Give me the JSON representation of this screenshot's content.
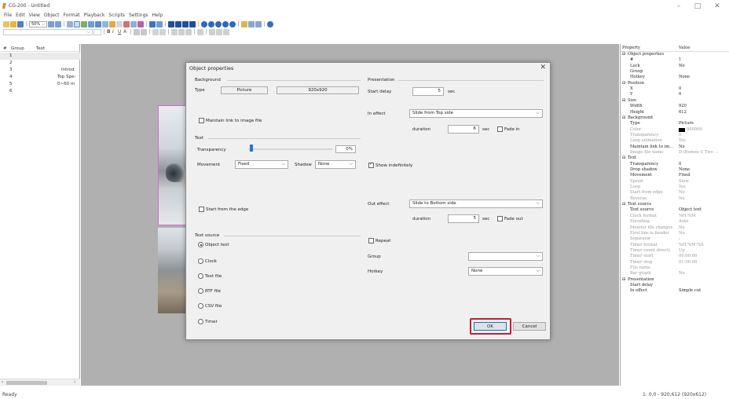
{
  "window": {
    "title": "CG-200 - Untitled"
  },
  "menu": [
    "File",
    "Edit",
    "View",
    "Object",
    "Format",
    "Playback",
    "Scripts",
    "Settings",
    "Help"
  ],
  "toolbar": {
    "zoom": "50%"
  },
  "list": {
    "headers": [
      "#",
      "Group",
      "Text"
    ],
    "rows": [
      {
        "num": "1",
        "group": "",
        "text": ""
      },
      {
        "num": "2",
        "group": "",
        "text": ""
      },
      {
        "num": "3",
        "group": "",
        "text": "Introd"
      },
      {
        "num": "4",
        "group": "",
        "text": "Top Spe-"
      },
      {
        "num": "5",
        "group": "",
        "text": "0~60 m"
      },
      {
        "num": "6",
        "group": "",
        "text": ""
      }
    ]
  },
  "properties": {
    "headers": [
      "Property",
      "Value"
    ],
    "rows": [
      {
        "name": "Object properties",
        "value": "",
        "section": true
      },
      {
        "name": "#",
        "value": "1"
      },
      {
        "name": "Lock",
        "value": "No"
      },
      {
        "name": "Group",
        "value": ""
      },
      {
        "name": "Hotkey",
        "value": "None"
      },
      {
        "name": "Position",
        "value": "",
        "section": true
      },
      {
        "name": "X",
        "value": "0"
      },
      {
        "name": "Y",
        "value": "0"
      },
      {
        "name": "Size",
        "value": "",
        "section": true
      },
      {
        "name": "Width",
        "value": "920"
      },
      {
        "name": "Height",
        "value": "612"
      },
      {
        "name": "Background",
        "value": "",
        "section": true
      },
      {
        "name": "Type",
        "value": "Picture"
      },
      {
        "name": "Color",
        "value": "000000",
        "dim": true,
        "swatch": true
      },
      {
        "name": "Transparency",
        "value": "0",
        "dim": true
      },
      {
        "name": "Loop animation",
        "value": "Yes",
        "dim": true
      },
      {
        "name": "Maintain link to im...",
        "value": "No"
      },
      {
        "name": "Image file name",
        "value": "D:\\Romeo C Two ...",
        "dim": true
      },
      {
        "name": "Text",
        "value": "",
        "section": true
      },
      {
        "name": "Transparency",
        "value": "0"
      },
      {
        "name": "Drop shadow",
        "value": "None"
      },
      {
        "name": "Movement",
        "value": "Fixed"
      },
      {
        "name": "Speed",
        "value": "Slow",
        "dim": true
      },
      {
        "name": "Loop",
        "value": "Yes",
        "dim": true
      },
      {
        "name": "Start from edge",
        "value": "No",
        "dim": true
      },
      {
        "name": "Reverse",
        "value": "No",
        "dim": true
      },
      {
        "name": "Text source",
        "value": "",
        "section": true
      },
      {
        "name": "Text source",
        "value": "Object text"
      },
      {
        "name": "Clock format",
        "value": "%H:%M",
        "dim": true
      },
      {
        "name": "Encoding",
        "value": "Auto",
        "dim": true
      },
      {
        "name": "Monitor file changes",
        "value": "No",
        "dim": true
      },
      {
        "name": "First line is header",
        "value": "No",
        "dim": true
      },
      {
        "name": "Separator",
        "value": ";",
        "dim": true
      },
      {
        "name": "Timer format",
        "value": "%H:%M:%S",
        "dim": true
      },
      {
        "name": "Timer count directi",
        "value": "Up",
        "dim": true
      },
      {
        "name": "Timer start",
        "value": "00:00:00",
        "dim": true
      },
      {
        "name": "Timer stop",
        "value": "01:00:00",
        "dim": true
      },
      {
        "name": "File name",
        "value": "",
        "dim": true
      },
      {
        "name": "Bar graph",
        "value": "No",
        "dim": true
      },
      {
        "name": "Presentation",
        "value": "",
        "section": true
      },
      {
        "name": "Start delay",
        "value": ""
      },
      {
        "name": "In effect",
        "value": "Simple cut"
      }
    ]
  },
  "dialog": {
    "title": "Object properties",
    "background_label": "Background",
    "type_label": "Type",
    "type_value": "Picture",
    "size_value": "920x920",
    "maintain_link": "Maintain link to image file",
    "text_label": "Text",
    "transparency_label": "Transparency",
    "transparency_value": "0%",
    "movement_label": "Movement",
    "movement_value": "Fixed",
    "shadow_label": "Shadow",
    "shadow_value": "None",
    "start_edge": "Start from the edge",
    "text_source_label": "Text source",
    "sources": [
      "Object text",
      "Clock",
      "Text file",
      "RTF file",
      "CSV file",
      "Timer"
    ],
    "presentation_label": "Presentation",
    "start_delay_label": "Start delay",
    "start_delay_value": "5",
    "sec": "sec",
    "in_effect_label": "In effect",
    "in_effect_value": "Slide from Top side",
    "duration_label": "duration",
    "in_duration": "6",
    "fade_in": "Fade in",
    "show_indef": "Show indefinitely",
    "out_effect_label": "Out effect",
    "out_effect_value": "Slide to Bottom side",
    "out_duration": "5",
    "fade_out": "Fade out",
    "repeat": "Repeat",
    "group_label": "Group",
    "hotkey_label": "Hotkey",
    "hotkey_value": "None",
    "ok": "OK",
    "cancel": "Cancel"
  },
  "status": {
    "left": "Ready",
    "right": "1: 0,0 - 920,612 (920x612)"
  }
}
